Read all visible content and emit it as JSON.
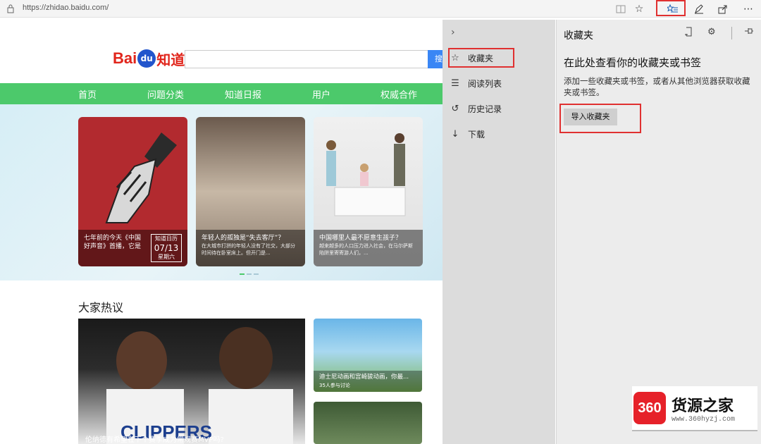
{
  "browser": {
    "url": "https://zhidao.baidu.com/",
    "icons": [
      "reading-view-icon",
      "star-icon",
      "hub-icon",
      "pen-icon",
      "share-icon",
      "more-icon"
    ]
  },
  "page": {
    "logo": {
      "bai": "Bai",
      "du": "du",
      "zhidao": "知道"
    },
    "search_button": "搜",
    "nav": [
      "首页",
      "问题分类",
      "知道日报",
      "用户",
      "权威合作"
    ],
    "cards": [
      {
        "title": "七年前的今天《中国好声音》首播，它是",
        "date_label": "知道日历",
        "date": "07/13",
        "weekday": "星期六"
      },
      {
        "title": "年轻人的孤独是“失去客厅”？",
        "sub": "在大城市打拼的年轻人没有了社交，大部分时间待在卧室床上。但开门是..."
      },
      {
        "title": "中国哪里人最不愿意生孩子？",
        "sub": "越来越多的人口压力进入社会，在马尔萨斯陷阱里寄寄游人们，..."
      }
    ],
    "hot_title": "大家热议",
    "hot_big_caption": "伦纳德有希望在下个赛季成为常规赛MVP吗?",
    "hot_small": {
      "title": "迪士尼动画和宫崎骏动画，你最...",
      "meta": "35人参与讨论"
    }
  },
  "hub": {
    "items": [
      {
        "icon": "star-icon",
        "label": "收藏夹"
      },
      {
        "icon": "reading-list-icon",
        "label": "阅读列表"
      },
      {
        "icon": "history-icon",
        "label": "历史记录"
      },
      {
        "icon": "download-icon",
        "label": "下载"
      }
    ]
  },
  "favorites": {
    "title": "收藏夹",
    "heading": "在此处查看你的收藏夹或书签",
    "description": "添加一些收藏夹或书签，或者从其他浏览器获取收藏夹或书签。",
    "import_button": "导入收藏夹"
  },
  "watermark": {
    "badge": "360",
    "name": "货源之家",
    "site": "www.360hyzj.com"
  },
  "colors": {
    "nav_green": "#4cc96b",
    "highlight_red": "#e03030",
    "baidu_red": "#e1251b",
    "baidu_blue": "#2255cc"
  }
}
